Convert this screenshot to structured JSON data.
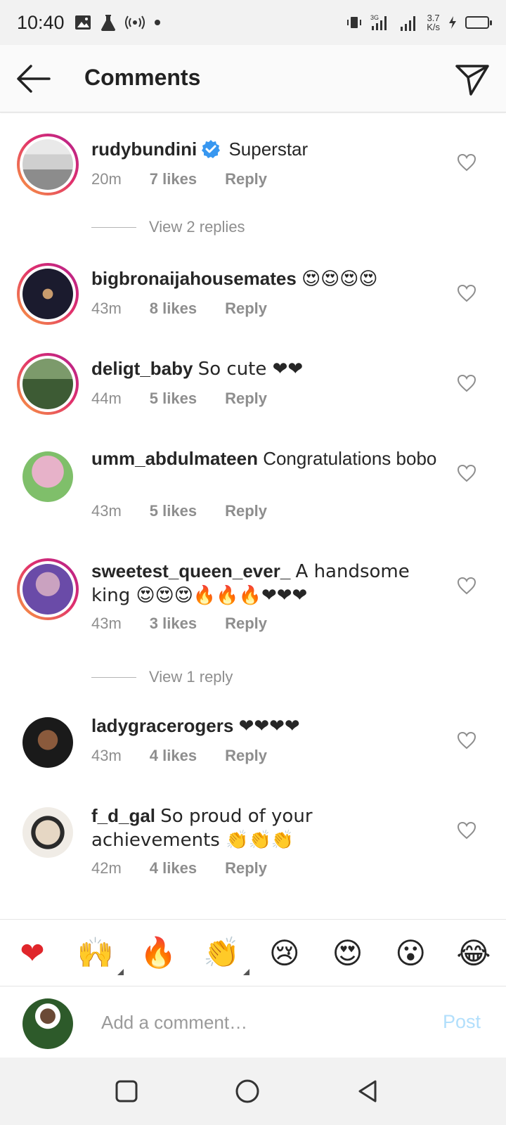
{
  "status_bar": {
    "time": "10:40",
    "network_speed_value": "3.7",
    "network_speed_unit": "K/s",
    "network_type": "3G"
  },
  "header": {
    "title": "Comments"
  },
  "comments": [
    {
      "username": "rudybundini",
      "verified": true,
      "text": "Superstar",
      "time": "20m",
      "likes": "7 likes",
      "reply": "Reply",
      "view_replies": "View 2 replies"
    },
    {
      "username": "bigbronaijahousemates",
      "text": "😍😍😍😍",
      "time": "43m",
      "likes": "8 likes",
      "reply": "Reply"
    },
    {
      "username": "deligt_baby",
      "text": "So cute ❤❤",
      "time": "44m",
      "likes": "5 likes",
      "reply": "Reply"
    },
    {
      "username": "umm_abdulmateen",
      "text": "Congratulations bobo",
      "time": "43m",
      "likes": "5 likes",
      "reply": "Reply"
    },
    {
      "username": "sweetest_queen_ever_",
      "text": "A handsome king 😍😍😍🔥🔥🔥❤❤❤",
      "time": "43m",
      "likes": "3 likes",
      "reply": "Reply",
      "view_replies": "View 1 reply"
    },
    {
      "username": "ladygracerogers",
      "text": "❤❤❤❤",
      "time": "43m",
      "likes": "4 likes",
      "reply": "Reply"
    },
    {
      "username": "f_d_gal",
      "text": "So proud of your achievements 👏👏👏",
      "time": "42m",
      "likes": "4 likes",
      "reply": "Reply"
    }
  ],
  "quick_reactions": [
    "❤",
    "🙌",
    "🔥",
    "👏",
    "😢",
    "😍",
    "😮",
    "😂"
  ],
  "compose": {
    "placeholder": "Add a comment…",
    "post_label": "Post"
  },
  "colors": {
    "post_disabled": "#b2dffc",
    "verified_blue": "#3897f0",
    "meta_gray": "#8e8e8e",
    "story_ring_start": "#f9a03f",
    "story_ring_end": "#b1208f"
  },
  "icons": {
    "back": "arrow-left-icon",
    "send": "paper-plane-icon",
    "like": "heart-outline-icon",
    "verified": "verified-badge-icon",
    "nav": [
      "square-recents-icon",
      "circle-home-icon",
      "triangle-back-icon"
    ]
  }
}
